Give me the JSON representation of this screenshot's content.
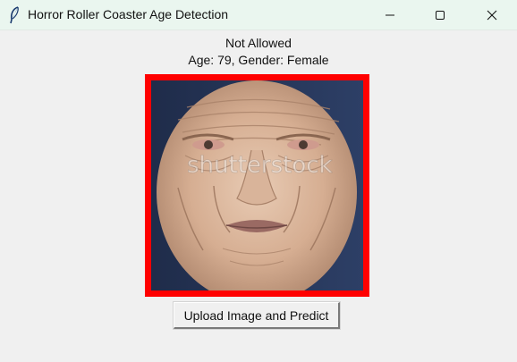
{
  "window": {
    "title": "Horror Roller Coaster Age Detection",
    "icon": "feather-icon",
    "controls": {
      "minimize": "minimize-icon",
      "maximize": "maximize-icon",
      "close": "close-icon"
    }
  },
  "result": {
    "status": "Not Allowed",
    "details": "Age: 79, Gender: Female",
    "frame_color": "#ff0000"
  },
  "photo": {
    "subject": "elderly woman face",
    "watermark": "shutterstock"
  },
  "actions": {
    "upload_label": "Upload Image and Predict"
  }
}
